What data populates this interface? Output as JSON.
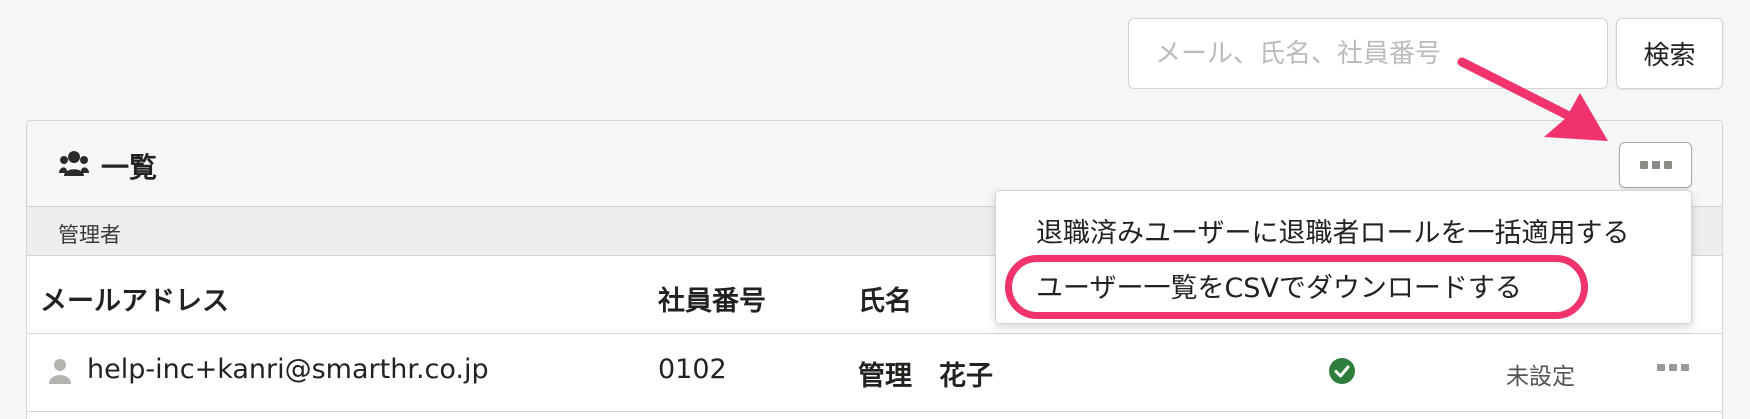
{
  "search": {
    "placeholder": "メール、氏名、社員番号",
    "button_label": "検索"
  },
  "panel": {
    "title": "一覧",
    "group_label": "管理者",
    "columns": [
      "メールアドレス",
      "社員番号",
      "氏名"
    ],
    "rows": [
      {
        "email": "help-inc+kanri@smarthr.co.jp",
        "employee_number": "0102",
        "name": "管理　花子",
        "status": "未設定"
      }
    ]
  },
  "dropdown": {
    "items": [
      "退職済みユーザーに退職者ロールを一括適用する",
      "ユーザー一覧をCSVでダウンロードする"
    ]
  },
  "icons": {
    "title_icon": "users-icon",
    "row_icon": "user-icon",
    "status_icon": "check-circle-icon",
    "more_icon": "more-dots-icon"
  },
  "colors": {
    "highlight": "#f0336d",
    "check": "#2f7d3c"
  }
}
